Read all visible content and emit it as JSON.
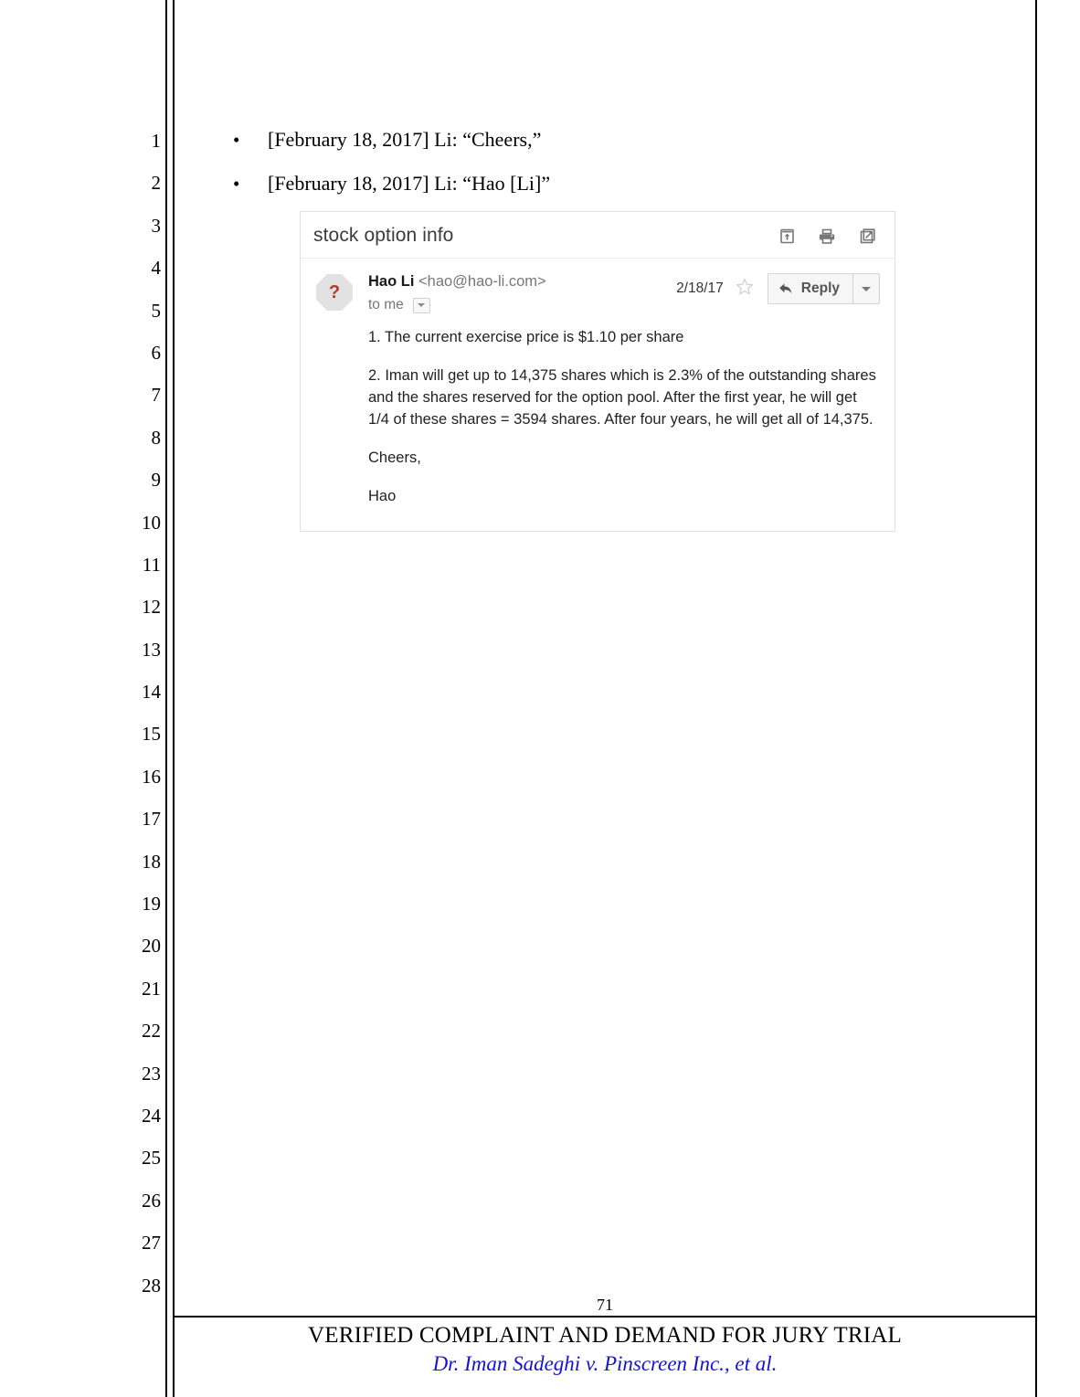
{
  "document": {
    "line_numbers": [
      "1",
      "2",
      "3",
      "4",
      "5",
      "6",
      "7",
      "8",
      "9",
      "10",
      "11",
      "12",
      "13",
      "14",
      "15",
      "16",
      "17",
      "18",
      "19",
      "20",
      "21",
      "22",
      "23",
      "24",
      "25",
      "26",
      "27",
      "28"
    ],
    "bullets": [
      {
        "marker": "•",
        "text": "[February 18, 2017] Li: “Cheers,”"
      },
      {
        "marker": "•",
        "text": "[February 18, 2017] Li: “Hao [Li]”"
      }
    ],
    "footer": {
      "page_number": "71",
      "title": "VERIFIED COMPLAINT AND DEMAND FOR JURY TRIAL",
      "caption": "Dr. Iman Sadeghi v. Pinscreen Inc., et al.",
      "caption_color": "#1414d2"
    }
  },
  "email": {
    "subject": "stock option info",
    "actions": [
      {
        "name": "move-to-inbox-icon",
        "label": "Move to Inbox"
      },
      {
        "name": "print-icon",
        "label": "Print"
      },
      {
        "name": "open-in-new-window-icon",
        "label": "Open in new window"
      }
    ],
    "avatar_glyph": "?",
    "sender_name": "Hao Li",
    "sender_email": "<hao@hao-li.com>",
    "recipient": "to me",
    "date": "2/18/17",
    "star_label": "☆",
    "reply_label": "Reply",
    "body": [
      "1. The current exercise price is $1.10 per share",
      "2. Iman will get up to 14,375 shares which is 2.3% of the outstanding shares and the shares reserved for the option pool.  After the first year, he will get 1/4 of these shares = 3594 shares.  After four years, he will get all of 14,375.",
      "Cheers,",
      "Hao"
    ]
  }
}
